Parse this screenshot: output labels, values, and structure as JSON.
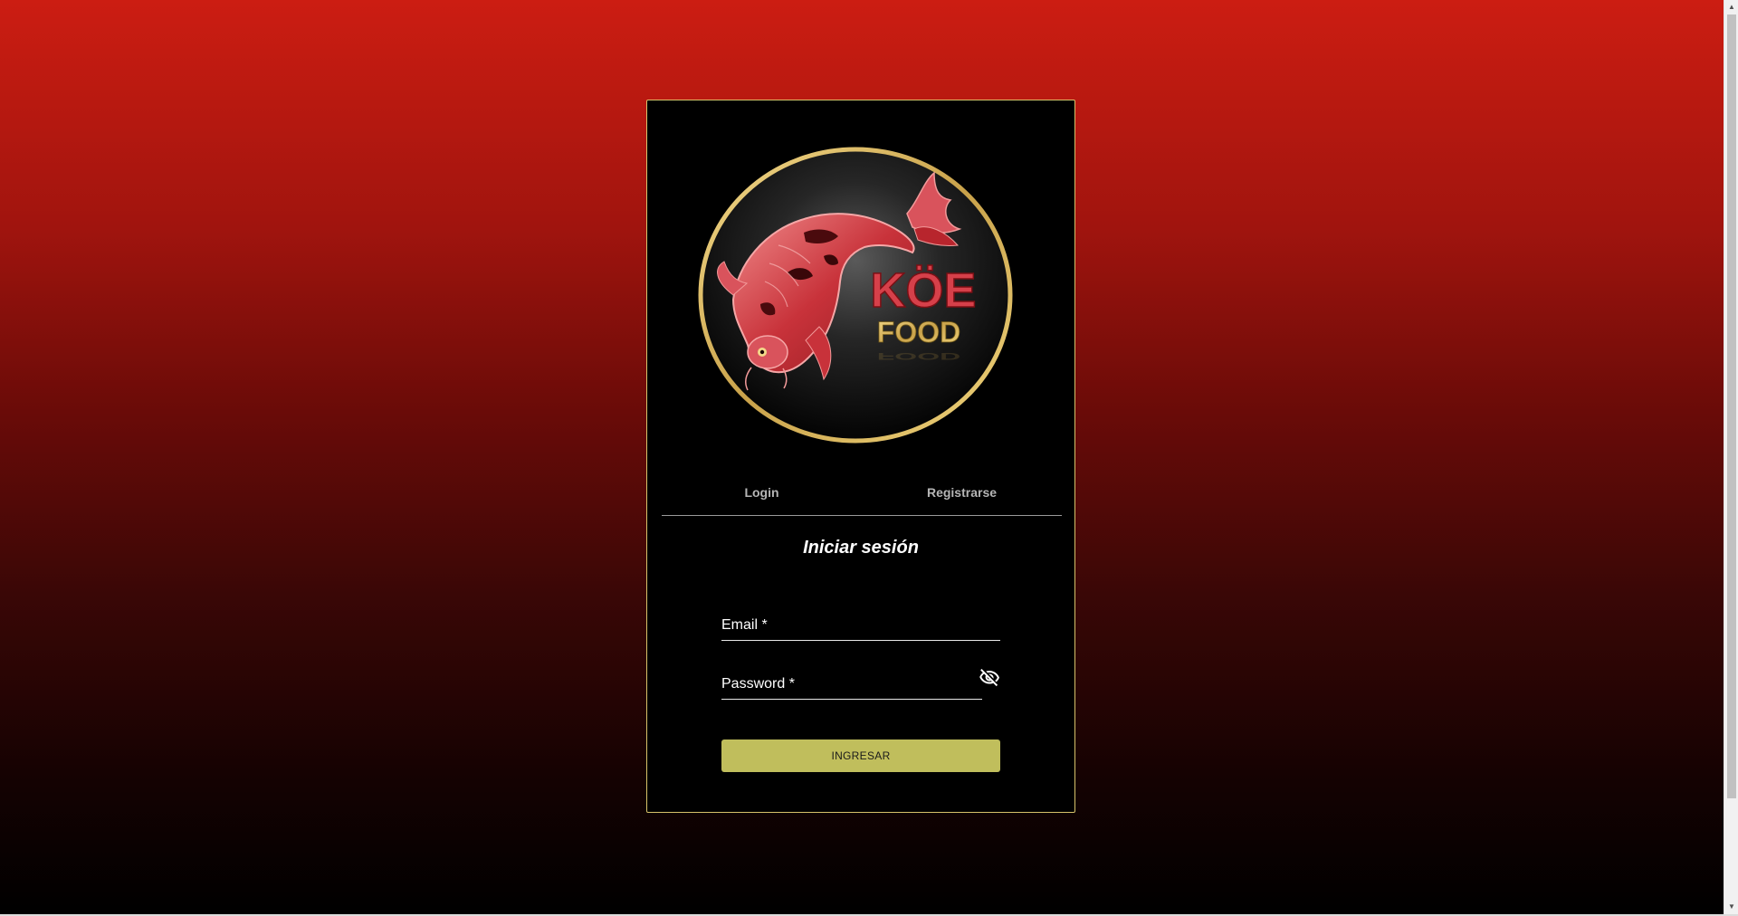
{
  "brand": {
    "line1": "KÖE",
    "line2": "FOOD"
  },
  "tabs": [
    {
      "label": "Login"
    },
    {
      "label": "Registrarse"
    }
  ],
  "form": {
    "title": "Iniciar sesión",
    "email_label": "Email *",
    "password_label": "Password *",
    "password_toggle_icon": "eye-off-icon",
    "submit_label": "INGRESAR"
  },
  "colors": {
    "accent_gold": "#d8c36a",
    "button": "#c0be5c",
    "gradient_top": "#cc1d12",
    "gradient_bottom": "#000000",
    "koi_red": "#c8323a"
  }
}
